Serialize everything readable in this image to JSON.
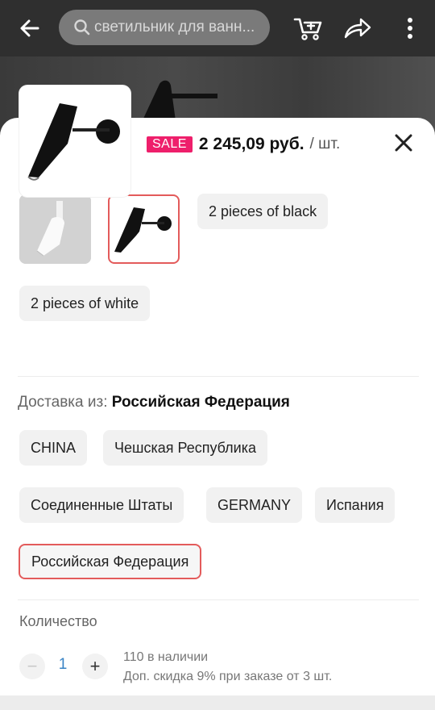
{
  "search": {
    "placeholder": "светильник для ванн..."
  },
  "product": {
    "sale_badge": "SALE",
    "price": "2 245,09 руб.",
    "unit": "/ шт."
  },
  "variants": {
    "options": [
      "2 pieces of black",
      "2 pieces of white"
    ]
  },
  "shipping": {
    "label": "Доставка из:",
    "selected": "Российская Федерация",
    "options": [
      "CHINA",
      "Чешская Республика",
      "Соединенные Штаты",
      "GERMANY",
      "Испания",
      "Российская Федерация"
    ]
  },
  "quantity": {
    "label": "Количество",
    "minus": "−",
    "value": "1",
    "plus": "+",
    "stock": "110 в наличии",
    "discount": "Доп. скидка 9% при заказе от 3 шт."
  },
  "colors": {
    "sale": "#ee1f6b",
    "selected_border": "#e35b5b",
    "qty_value": "#3a84c5"
  },
  "icons": [
    "back-arrow-icon",
    "search-icon",
    "cart-icon",
    "share-icon",
    "more-vertical-icon",
    "close-icon"
  ]
}
